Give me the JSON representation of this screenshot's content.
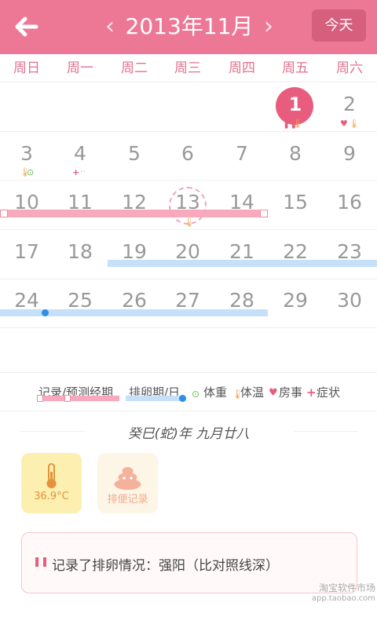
{
  "header": {
    "back": "back-arrow",
    "prev": "‹",
    "title": "2013年11月",
    "next": "›",
    "today_label": "今天"
  },
  "weekdays": [
    "周日",
    "周一",
    "周二",
    "周三",
    "周四",
    "周五",
    "周六"
  ],
  "calendar": {
    "today": 1,
    "predicted_day": 13,
    "days": [
      1,
      2,
      3,
      4,
      5,
      6,
      7,
      8,
      9,
      10,
      11,
      12,
      13,
      14,
      15,
      16,
      17,
      18,
      19,
      20,
      21,
      22,
      23,
      24,
      25,
      26,
      27,
      28,
      29,
      30
    ]
  },
  "legend": {
    "period_label": "记录/预测经期",
    "ovulation_label": "排卵期/日",
    "weight_label": "体重",
    "temp_label": "体温",
    "sex_label": "房事",
    "symptom_label": "症状"
  },
  "lunar": "癸巳(蛇)年  九月廿八",
  "cards": {
    "temperature": "36.9°C",
    "bowel": "排便记录"
  },
  "record": {
    "text": "记录了排卵情况：强阳（比对照线深）"
  },
  "watermark": {
    "line1": "淘宝软件市场",
    "line2": "app.taobao.com"
  },
  "colors": {
    "header": "#ec7896",
    "accent": "#e85d7e",
    "period": "#f8a9bd",
    "ovulation": "#c5e0f8"
  }
}
